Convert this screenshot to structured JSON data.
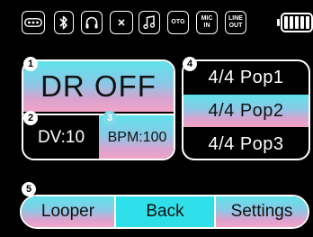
{
  "status_bar": {
    "icons": [
      "dots-icon",
      "bluetooth-icon",
      "headphones-icon",
      "mute-icon",
      "music-note-icon",
      "otg-icon",
      "mic-in-icon",
      "line-out-icon",
      "battery-icon"
    ],
    "otg_label": "OTG",
    "mic_in_label_1": "MIC",
    "mic_in_label_2": "IN",
    "line_out_label_1": "LINE",
    "line_out_label_2": "OUT",
    "battery_level": 1.0
  },
  "markers": {
    "m1": "1",
    "m2": "2",
    "m3": "3",
    "m4": "4",
    "m5": "5"
  },
  "drum": {
    "status": "DR OFF",
    "dv": "DV:10",
    "bpm": "BPM:100"
  },
  "presets": [
    {
      "label": "4/4 Pop1",
      "active": false
    },
    {
      "label": "4/4 Pop2",
      "active": true
    },
    {
      "label": "4/4 Pop3",
      "active": false
    }
  ],
  "bottom": {
    "looper": "Looper",
    "back": "Back",
    "settings": "Settings"
  },
  "colors": {
    "gradient_top": "#5fe3ea",
    "gradient_bottom": "#f2a3c6",
    "back_button": "#2fe0ea",
    "background": "#000000"
  }
}
